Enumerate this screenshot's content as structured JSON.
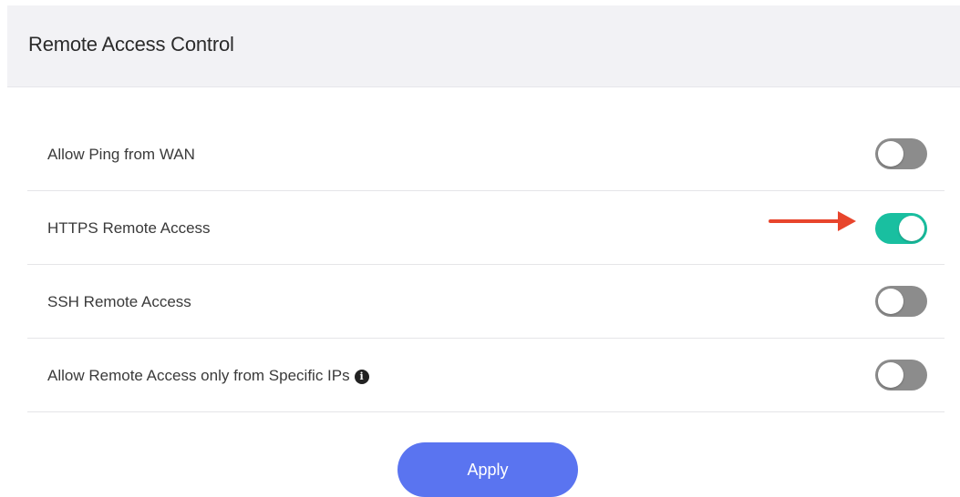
{
  "header": {
    "title": "Remote Access Control"
  },
  "settings": [
    {
      "label": "Allow Ping from WAN",
      "enabled": false
    },
    {
      "label": "HTTPS Remote Access",
      "enabled": true
    },
    {
      "label": "SSH Remote Access",
      "enabled": false
    },
    {
      "label": "Allow Remote Access only from Specific IPs",
      "enabled": false,
      "info_icon": "info-icon"
    }
  ],
  "annotation": {
    "icon": "arrow-right-icon",
    "color": "#e8452c"
  },
  "colors": {
    "toggle_on": "#19bfa0",
    "toggle_off": "#8c8c8c",
    "apply_button": "#5a74f0",
    "header_bg": "#f2f2f5"
  },
  "footer": {
    "apply_label": "Apply"
  }
}
